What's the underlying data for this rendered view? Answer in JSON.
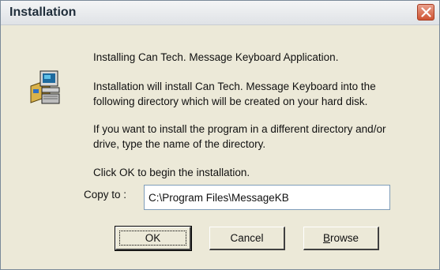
{
  "window": {
    "title": "Installation"
  },
  "messages": {
    "line1": "Installing Can Tech. Message Keyboard Application.",
    "line2a": "Installation will install Can Tech. Message Keyboard into the",
    "line2b": "following directory which will be created on your hard disk.",
    "line3a": "If you want to install the program in a different directory and/or",
    "line3b": "drive, type the name of the directory.",
    "line4": "Click OK to begin the installation."
  },
  "copy_to": {
    "label": "Copy to :",
    "value": "C:\\Program Files\\MessageKB"
  },
  "buttons": {
    "ok": "OK",
    "cancel": "Cancel",
    "browse_first": "B",
    "browse_rest": "rowse"
  },
  "icons": {
    "close": "close-icon",
    "app": "computer-setup-icon"
  }
}
